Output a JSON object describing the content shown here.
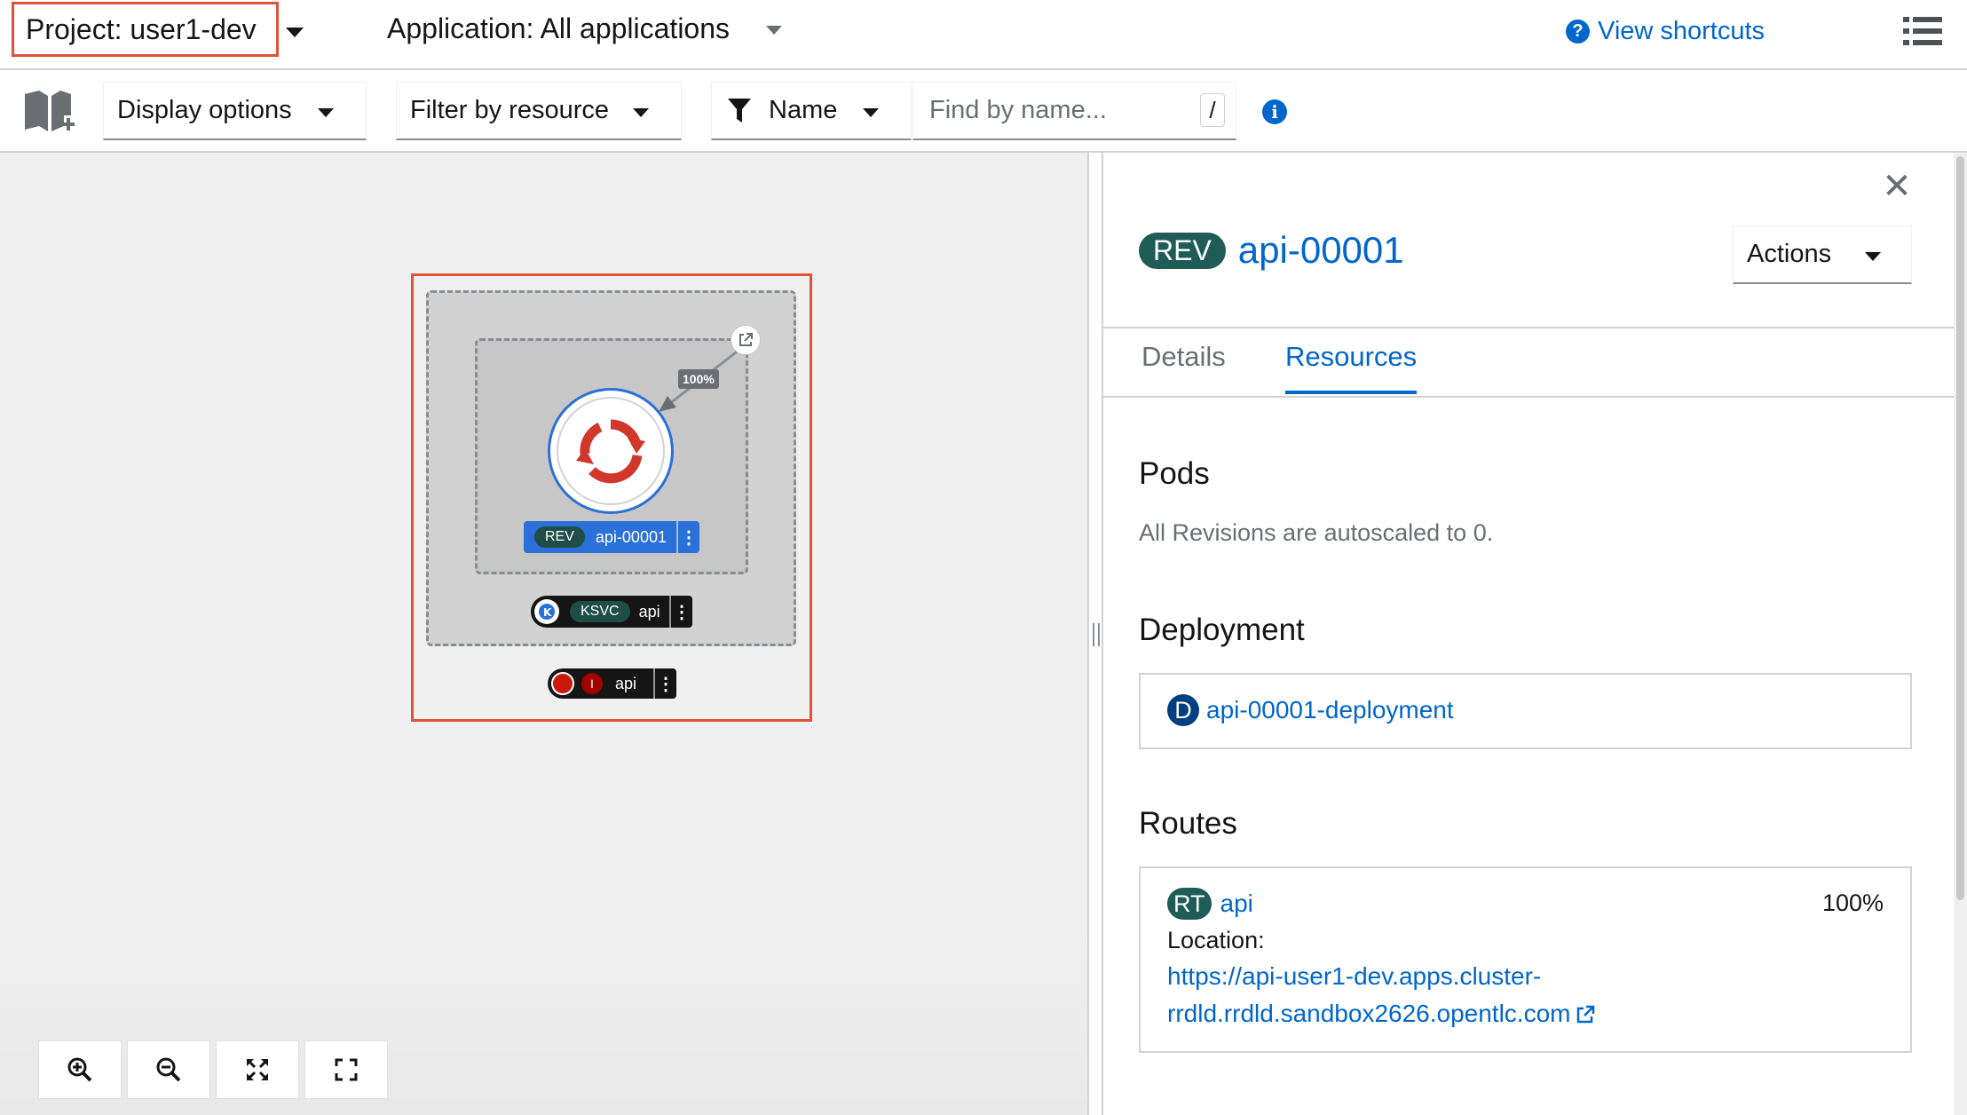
{
  "project_bar": {
    "project_label": "Project: user1-dev",
    "application_label": "Application: All applications",
    "shortcuts_label": "View shortcuts"
  },
  "toolbar": {
    "display_options": "Display options",
    "filter_by_resource": "Filter by resource",
    "filter_type": "Name",
    "search_placeholder": "Find by name...",
    "slash_hint": "/"
  },
  "topology": {
    "traffic_percent": "100%",
    "revision_tag": "REV",
    "revision_name": "api-00001",
    "ksvc_tag": "KSVC",
    "ksvc_name": "api",
    "route_tag": "I",
    "route_name": "api"
  },
  "panel": {
    "badge": "REV",
    "title": "api-00001",
    "actions_label": "Actions",
    "tabs": [
      {
        "label": "Details",
        "active": false
      },
      {
        "label": "Resources",
        "active": true
      }
    ],
    "pods": {
      "title": "Pods",
      "message": "All Revisions are autoscaled to 0."
    },
    "deployment": {
      "title": "Deployment",
      "badge": "D",
      "name": "api-00001-deployment"
    },
    "routes": {
      "title": "Routes",
      "badge": "RT",
      "name": "api",
      "percent": "100%",
      "location_label": "Location:",
      "url": "https://api-user1-dev.apps.cluster-rrdld.rrdld.sandbox2626.opentlc.com"
    }
  },
  "colors": {
    "link": "#0066cc",
    "highlight": "#e0513a",
    "rev_blue": "#2b6fd8",
    "badge_teal": "#1f5c56"
  }
}
